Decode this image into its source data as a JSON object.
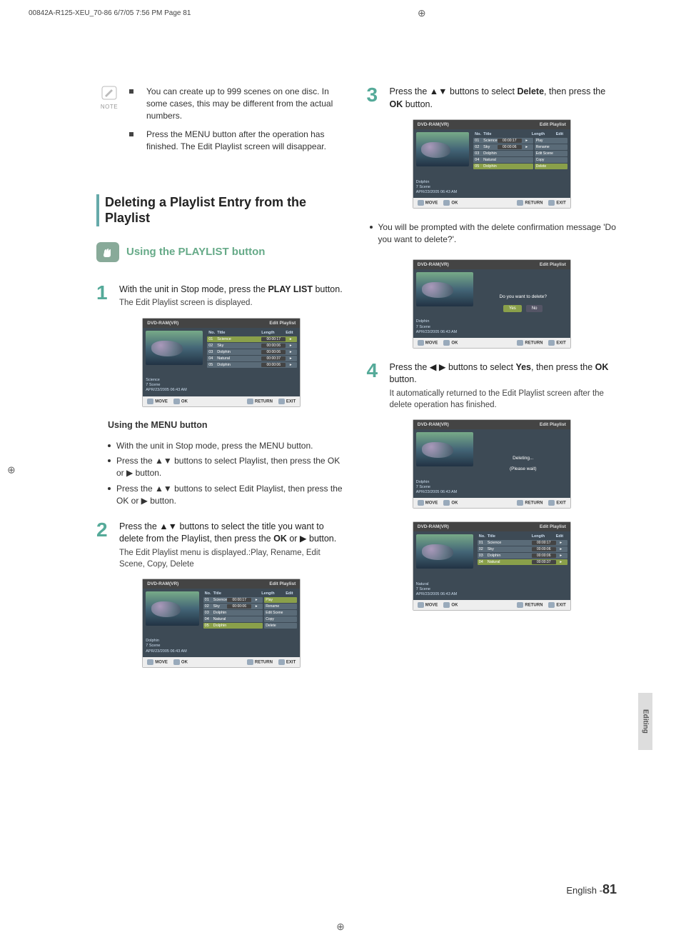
{
  "print": {
    "header": "00842A-R125-XEU_70-86  6/7/05  7:56 PM  Page 81"
  },
  "leftCol": {
    "noteLabel": "NOTE",
    "notes": [
      "You can create up to 999 scenes on one disc. In some cases, this may be different from the actual numbers.",
      "Press the MENU button after the operation has finished. The Edit Playlist screen will disappear."
    ],
    "sectionTitle": "Deleting a Playlist Entry from the Playlist",
    "subTitle": "Using the PLAYLIST button",
    "step1_a": "With the unit in Stop mode, press the ",
    "step1_b": "PLAY LIST",
    "step1_c": " button.",
    "step1_small": "The Edit Playlist screen is displayed.",
    "usingMenuHdr": "Using the MENU button",
    "menuBullets": [
      "With the unit in Stop mode, press the MENU button.",
      "Press the ▲▼ buttons to select Playlist, then press the OK or ▶ button.",
      "Press the ▲▼ buttons to select Edit Playlist, then press the OK or ▶ button."
    ],
    "step2_a": "Press the ▲▼ buttons to select the title you want to delete from the Playlist, then press the ",
    "step2_b": "OK",
    "step2_c": " or ▶ button.",
    "step2_small": "The Edit Playlist menu is displayed.:Play, Rename, Edit Scene, Copy, Delete"
  },
  "rightCol": {
    "step3_a": "Press the ▲▼ buttons to select ",
    "step3_b": "Delete",
    "step3_c": ", then press the ",
    "step3_d": "OK",
    "step3_e": " button.",
    "postStep3Bullet": "You will be prompted with the delete confirmation message 'Do you want to delete?'.",
    "step4_a": "Press the ◀ ▶ buttons to select ",
    "step4_b": "Yes",
    "step4_c": ", then press the ",
    "step4_d": "OK",
    "step4_e": " button.",
    "step4_small": "It automatically returned to the Edit Playlist screen after the delete operation has finished."
  },
  "osd": {
    "disc": "DVD-RAM(VR)",
    "screenTitle": "Edit Playlist",
    "cols": {
      "no": "No.",
      "title": "Title",
      "length": "Length",
      "edit": "Edit"
    },
    "rows5": [
      {
        "no": "01",
        "title": "Science",
        "len": "00:00:17"
      },
      {
        "no": "02",
        "title": "Sky",
        "len": "00:00:06"
      },
      {
        "no": "03",
        "title": "Dolphin",
        "len": "00:00:06"
      },
      {
        "no": "04",
        "title": "Natural",
        "len": "00:00:37"
      },
      {
        "no": "05",
        "title": "Dolphin",
        "len": "00:00:06"
      }
    ],
    "rows4": [
      {
        "no": "01",
        "title": "Science",
        "len": "00:00:17"
      },
      {
        "no": "02",
        "title": "Sky",
        "len": "00:00:06"
      },
      {
        "no": "03",
        "title": "Dolphin",
        "len": "00:00:06"
      },
      {
        "no": "04",
        "title": "Natural",
        "len": "00:00:37"
      }
    ],
    "menuItems": [
      "Play",
      "Rename",
      "Edit Scene",
      "Copy",
      "Delete"
    ],
    "metaScience": "Science",
    "metaDolphin": "Dolphin",
    "metaNatural": "Natural",
    "metaScenes": "7 Scene",
    "metaDate": "APR/23/2005 06:43 AM",
    "confirmMsg": "Do you want to delete?",
    "yes": "Yes",
    "no": "No",
    "deleting": "Deleting...",
    "pleaseWait": "(Please wait)",
    "bottom": {
      "move": "MOVE",
      "ok": "OK",
      "return": "RETURN",
      "exit": "EXIT"
    }
  },
  "footer": {
    "lang": "English -",
    "page": "81"
  },
  "sideTab": "Editing"
}
